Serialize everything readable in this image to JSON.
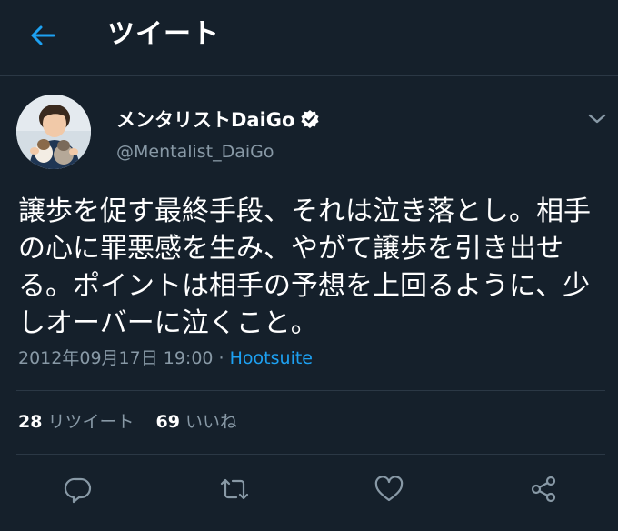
{
  "header": {
    "title": "ツイート",
    "back_icon": "arrow-left-icon"
  },
  "tweet": {
    "display_name": "メンタリストDaiGo",
    "handle": "@Mentalist_DaiGo",
    "verified_icon": "verified-badge-icon",
    "text": "譲歩を促す最終手段、それは泣き落とし。相手の心に罪悪感を生み、やがて譲歩を引き出せる。ポイントは相手の予想を上回るように、少しオーバーに泣くこと。",
    "timestamp": "2012年09月17日 19:00",
    "separator": " · ",
    "source": "Hootsuite"
  },
  "stats": {
    "retweets_count": "28",
    "retweets_label": "リツイート",
    "likes_count": "69",
    "likes_label": "いいね"
  },
  "actions": {
    "reply_icon": "reply-icon",
    "retweet_icon": "retweet-icon",
    "like_icon": "heart-icon",
    "share_icon": "share-icon"
  },
  "colors": {
    "background": "#15202b",
    "accent": "#1da1f2",
    "secondary_text": "#8899a6",
    "divider": "#2b3845"
  }
}
